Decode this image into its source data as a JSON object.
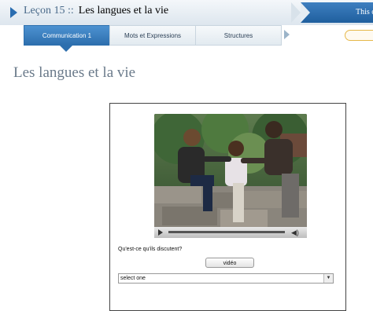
{
  "header": {
    "lesson_label": "Leçon 15 ::",
    "lesson_title": "Les langues et la vie",
    "crumb_right": "This c"
  },
  "tabs": [
    {
      "label": "Communication 1",
      "active": true
    },
    {
      "label": "Mots et Expressions",
      "active": false
    },
    {
      "label": "Structures",
      "active": false
    }
  ],
  "page_title": "Les langues et la vie",
  "activity": {
    "question": "Qu'est-ce qu'ils discutent?",
    "video_button": "vidéo",
    "select_value": "select one"
  },
  "colors": {
    "accent": "#2d6fae",
    "heading": "#6a7a8a"
  },
  "icons": {
    "lesson_arrow": "play-triangle",
    "play": "play-icon",
    "volume": "speaker-icon",
    "dropdown": "chevron-down-icon"
  }
}
